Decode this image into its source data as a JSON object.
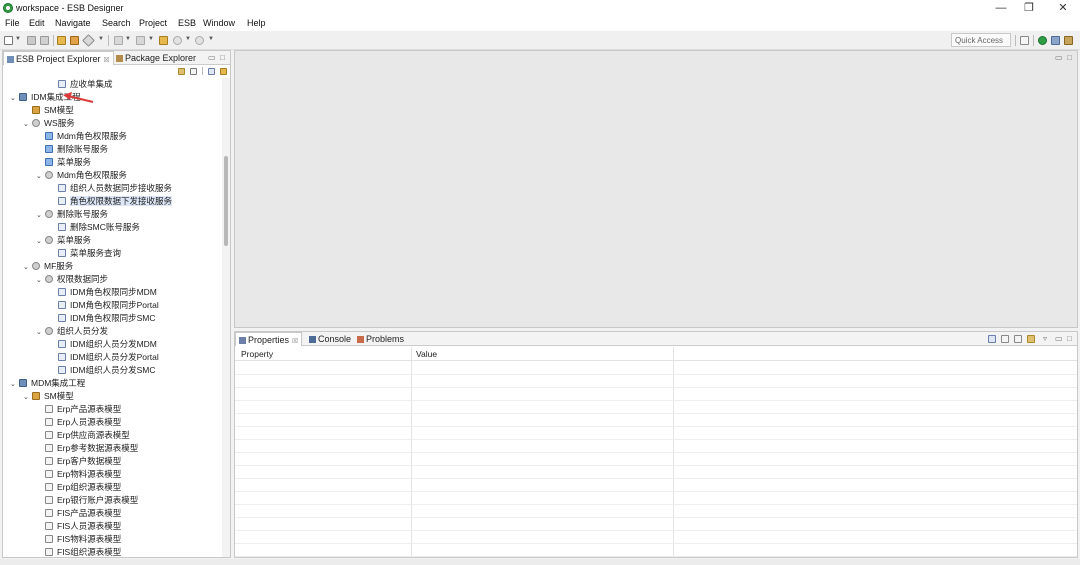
{
  "window": {
    "title": "workspace - ESB Designer",
    "minimize": "—",
    "maximize": "❐",
    "close": "✕"
  },
  "menu": [
    "File",
    "Edit",
    "Navigate",
    "Search",
    "Project",
    "ESB",
    "Window",
    "Help"
  ],
  "toolbar": {
    "quick_access": "Quick Access"
  },
  "left_panel": {
    "tabs": [
      {
        "label": "ESB Project Explorer",
        "close": "☒"
      },
      {
        "label": "Package Explorer"
      }
    ]
  },
  "tree": [
    {
      "label": "应收单集成",
      "icon": "op",
      "depth": 3,
      "twisty": ""
    },
    {
      "label": "IDM集成工程",
      "icon": "proj",
      "depth": 0,
      "twisty": "v"
    },
    {
      "label": "SM模型",
      "icon": "sm",
      "depth": 1,
      "twisty": ""
    },
    {
      "label": "WS服务",
      "icon": "ws",
      "depth": 1,
      "twisty": "v"
    },
    {
      "label": "Mdm角色权限服务",
      "icon": "svc",
      "depth": 2,
      "twisty": ""
    },
    {
      "label": "删除账号服务",
      "icon": "svc",
      "depth": 2,
      "twisty": ""
    },
    {
      "label": "菜单服务",
      "icon": "svc",
      "depth": 2,
      "twisty": ""
    },
    {
      "label": "Mdm角色权限服务",
      "icon": "ws",
      "depth": 2,
      "twisty": "v"
    },
    {
      "label": "组织人员数据同步接收服务",
      "icon": "op",
      "depth": 3,
      "twisty": ""
    },
    {
      "label": "角色权限数据下发接收服务",
      "icon": "op",
      "depth": 3,
      "twisty": "",
      "selected": true
    },
    {
      "label": "删除账号服务",
      "icon": "ws",
      "depth": 2,
      "twisty": "v"
    },
    {
      "label": "删除SMC账号服务",
      "icon": "op",
      "depth": 3,
      "twisty": ""
    },
    {
      "label": "菜单服务",
      "icon": "ws",
      "depth": 2,
      "twisty": "v"
    },
    {
      "label": "菜单服务查询",
      "icon": "op",
      "depth": 3,
      "twisty": ""
    },
    {
      "label": "MF服务",
      "icon": "ws",
      "depth": 1,
      "twisty": "v"
    },
    {
      "label": "权限数据同步",
      "icon": "ws",
      "depth": 2,
      "twisty": "v"
    },
    {
      "label": "IDM角色权限同步MDM",
      "icon": "op",
      "depth": 3,
      "twisty": ""
    },
    {
      "label": "IDM角色权限同步Portal",
      "icon": "op",
      "depth": 3,
      "twisty": ""
    },
    {
      "label": "IDM角色权限同步SMC",
      "icon": "op",
      "depth": 3,
      "twisty": ""
    },
    {
      "label": "组织人员分发",
      "icon": "ws",
      "depth": 2,
      "twisty": "v"
    },
    {
      "label": "IDM组织人员分发MDM",
      "icon": "op",
      "depth": 3,
      "twisty": ""
    },
    {
      "label": "IDM组织人员分发Portal",
      "icon": "op",
      "depth": 3,
      "twisty": ""
    },
    {
      "label": "IDM组织人员分发SMC",
      "icon": "op",
      "depth": 3,
      "twisty": ""
    },
    {
      "label": "MDM集成工程",
      "icon": "proj",
      "depth": 0,
      "twisty": "v"
    },
    {
      "label": "SM模型",
      "icon": "sm",
      "depth": 1,
      "twisty": "v"
    },
    {
      "label": "Erp产品源表模型",
      "icon": "file",
      "depth": 2,
      "twisty": ""
    },
    {
      "label": "Erp人员源表模型",
      "icon": "file",
      "depth": 2,
      "twisty": ""
    },
    {
      "label": "Erp供应商源表模型",
      "icon": "file",
      "depth": 2,
      "twisty": ""
    },
    {
      "label": "Erp参考数据源表模型",
      "icon": "file",
      "depth": 2,
      "twisty": ""
    },
    {
      "label": "Erp客户数据模型",
      "icon": "file",
      "depth": 2,
      "twisty": ""
    },
    {
      "label": "Erp物料源表模型",
      "icon": "file",
      "depth": 2,
      "twisty": ""
    },
    {
      "label": "Erp组织源表模型",
      "icon": "file",
      "depth": 2,
      "twisty": ""
    },
    {
      "label": "Erp银行账户源表模型",
      "icon": "file",
      "depth": 2,
      "twisty": ""
    },
    {
      "label": "FIS产品源表模型",
      "icon": "file",
      "depth": 2,
      "twisty": ""
    },
    {
      "label": "FIS人员源表模型",
      "icon": "file",
      "depth": 2,
      "twisty": ""
    },
    {
      "label": "FIS物料源表模型",
      "icon": "file",
      "depth": 2,
      "twisty": ""
    },
    {
      "label": "FIS组织源表模型",
      "icon": "file",
      "depth": 2,
      "twisty": ""
    }
  ],
  "bottom_panel": {
    "tabs": [
      {
        "label": "Properties",
        "close": "☒"
      },
      {
        "label": "Console"
      },
      {
        "label": "Problems"
      }
    ],
    "columns": [
      "Property",
      "Value"
    ]
  },
  "colors": {
    "accent": "#2f9e44",
    "annotation_arrow": "#d93a3a",
    "selection": "#dce6f5"
  }
}
